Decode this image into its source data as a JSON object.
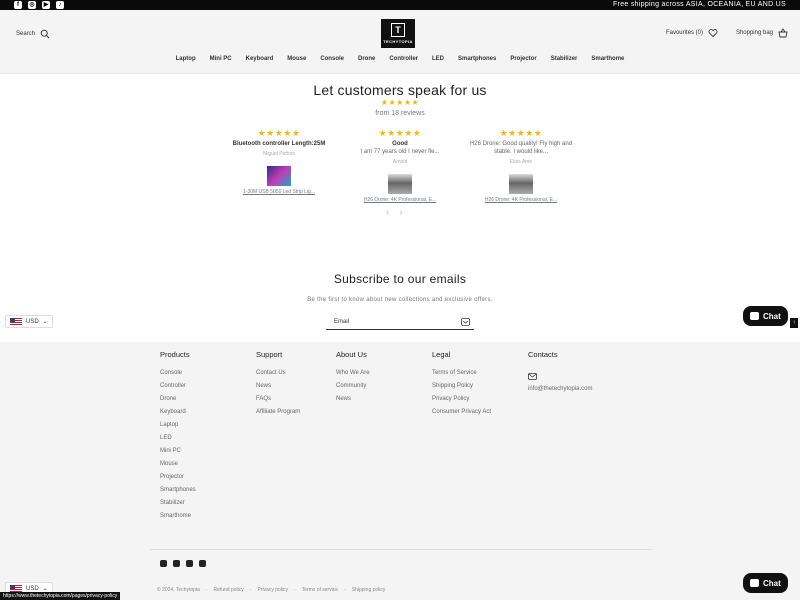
{
  "topbar": {
    "social": [
      "facebook-icon",
      "instagram-icon",
      "youtube-icon",
      "tiktok-icon"
    ],
    "shipping": "Free shipping across ASIA, OCEANIA, EU AND US"
  },
  "header": {
    "search_label": "Search",
    "logo_text": "TECHYTOPIA",
    "favourites_label": "Favourites (0)",
    "bag_label": "Shopping bag"
  },
  "nav": [
    "Laptop",
    "Mini PC",
    "Keyboard",
    "Mouse",
    "Console",
    "Drone",
    "Controller",
    "LED",
    "Smartphones",
    "Projector",
    "Stabilizer",
    "Smarthome"
  ],
  "reviews": {
    "title": "Let customers speak for us",
    "stars": "★★★★★",
    "count": "from 18 reviews",
    "cards": [
      {
        "stars": "★★★★★",
        "title": "Bluetooth controller Length:25M",
        "body": "",
        "author": "Miguel Pathos",
        "product": "1-30M USB 5050 Led Strip Lig..."
      },
      {
        "stars": "★★★★★",
        "title": "Good",
        "body": "I am 77 years old I never fle...",
        "author": "Arnold",
        "product": "H26 Drone: 4K Professional, E..."
      },
      {
        "stars": "★★★★★",
        "title": "",
        "body": "H26 Drone: Good quality! Fly high and stable. I would like...",
        "author": "Elias Amir",
        "product": "H26 Drone: 4K Professional, E..."
      }
    ],
    "prev": "‹",
    "next": "›"
  },
  "subscribe": {
    "title": "Subscribe to our emails",
    "text": "Be the first to know about new collections and exclusive offers.",
    "email_placeholder": "Email"
  },
  "currency": "USD",
  "chat_label": "Chat",
  "footer": {
    "products": {
      "heading": "Products",
      "items": [
        "Console",
        "Controller",
        "Drone",
        "Keyboard",
        "Laptop",
        "LED",
        "Mini PC",
        "Mouse",
        "Projector",
        "Smartphones",
        "Stabilizer",
        "Smarthome"
      ]
    },
    "support": {
      "heading": "Support",
      "items": [
        "Contact Us",
        "News",
        "FAQs",
        "Affiliate Program"
      ]
    },
    "about": {
      "heading": "About Us",
      "items": [
        "Who We Are",
        "Community",
        "News"
      ]
    },
    "legal": {
      "heading": "Legal",
      "items": [
        "Terms of Service",
        "Shipping Policy",
        "Privacy Policy",
        "Consumer Privacy Act"
      ]
    },
    "contacts": {
      "heading": "Contacts",
      "email": "info@thetechytopia.com"
    },
    "copyright": "© 2024, Techytopia",
    "legal_links": [
      "Refund policy",
      "Privacy policy",
      "Terms of service",
      "Shipping policy"
    ]
  },
  "status_url": "https://www.thetechytopia.com/pages/privacy-policy"
}
